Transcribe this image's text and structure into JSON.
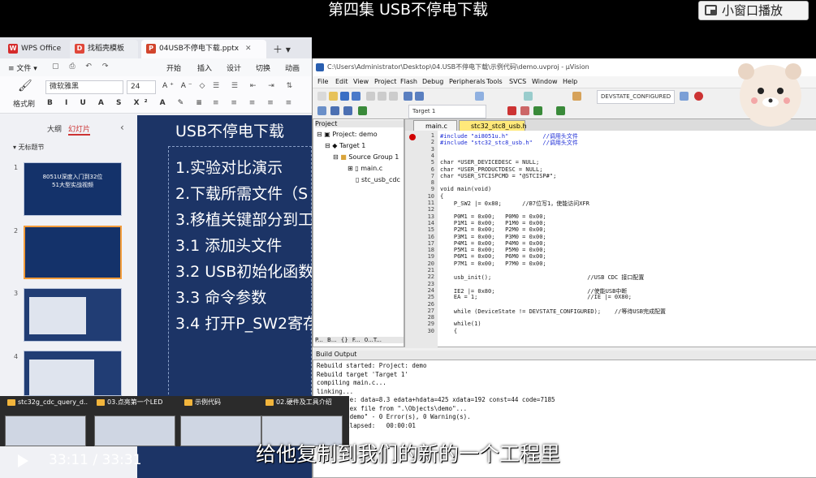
{
  "player": {
    "title": "第四集 USB不停电下载",
    "mini_window": "小窗口播放",
    "subtitle": "给他复制到我们的新的一个工程里",
    "time": "33:11 / 33:31"
  },
  "wps": {
    "tabs": [
      "WPS Office",
      "找稻壳模板",
      "04USB不停电下载.pptx"
    ],
    "menu": {
      "file": "文件",
      "items": [
        "开始",
        "插入",
        "设计",
        "切换",
        "动画"
      ]
    },
    "font": "微软雅黑",
    "size": "24",
    "format_painter": "格式刷",
    "side_tabs": [
      "大纲",
      "幻灯片"
    ],
    "section": "无标题节",
    "slide_numbers": [
      "1",
      "2",
      "3",
      "4"
    ],
    "thumb1_title": "8051U深度入门到32位\n51大型实战视频",
    "slide": {
      "title": "USB不停电下载",
      "lines": [
        "1.实验对比演示",
        "2.下载所需文件（S",
        "3.移植关键部分到工",
        "3.1 添加头文件",
        "3.2 USB初始化函数",
        "3.3 命令参数",
        "3.4 打开P_SW2寄存"
      ]
    }
  },
  "keil": {
    "title": "C:\\Users\\Administrator\\Desktop\\04.USB不停电下载\\示例代码\\demo.uvproj - µVision",
    "menu": [
      "File",
      "Edit",
      "View",
      "Project",
      "Flash",
      "Debug",
      "Peripherals",
      "Tools",
      "SVCS",
      "Window",
      "Help"
    ],
    "combo": "DEVSTATE_CONFIGURED",
    "target": "Target 1",
    "project_label": "Project",
    "tree": [
      "Project: demo",
      "Target 1",
      "Source Group 1",
      "main.c",
      "stc_usb_cdc"
    ],
    "panel_tabs": [
      "P...",
      "B...",
      "{} F...",
      "0...T..."
    ],
    "editor_tabs": [
      "main.c",
      "stc32_stc8_usb.h"
    ],
    "lines": [
      {
        "n": "1",
        "t": "#include \"ai8051u.h\"          //调用头文件",
        "c": "pp"
      },
      {
        "n": "2",
        "t": "#include \"stc32_stc8_usb.h\"   //调用头文件",
        "c": "pp"
      },
      {
        "n": "3",
        "t": "",
        "c": ""
      },
      {
        "n": "4",
        "t": "",
        "c": ""
      },
      {
        "n": "5",
        "t": "char *USER_DEVICEDESC = NULL;",
        "c": ""
      },
      {
        "n": "6",
        "t": "char *USER_PRODUCTDESC = NULL;",
        "c": ""
      },
      {
        "n": "7",
        "t": "char *USER_STCISPCMD = \"@STCISP#\";",
        "c": ""
      },
      {
        "n": "8",
        "t": "",
        "c": ""
      },
      {
        "n": "9",
        "t": "void main(void)",
        "c": ""
      },
      {
        "n": "10",
        "t": "{",
        "c": ""
      },
      {
        "n": "11",
        "t": "    P_SW2 |= 0x80;      //B7位写1，使能访问XFR",
        "c": ""
      },
      {
        "n": "12",
        "t": "",
        "c": ""
      },
      {
        "n": "13",
        "t": "    P0M1 = 0x00;   P0M0 = 0x00;",
        "c": ""
      },
      {
        "n": "14",
        "t": "    P1M1 = 0x00;   P1M0 = 0x00;",
        "c": ""
      },
      {
        "n": "15",
        "t": "    P2M1 = 0x00;   P2M0 = 0x00;",
        "c": ""
      },
      {
        "n": "16",
        "t": "    P3M1 = 0x00;   P3M0 = 0x00;",
        "c": ""
      },
      {
        "n": "17",
        "t": "    P4M1 = 0x00;   P4M0 = 0x00;",
        "c": ""
      },
      {
        "n": "18",
        "t": "    P5M1 = 0x00;   P5M0 = 0x00;",
        "c": ""
      },
      {
        "n": "19",
        "t": "    P6M1 = 0x00;   P6M0 = 0x00;",
        "c": ""
      },
      {
        "n": "20",
        "t": "    P7M1 = 0x00;   P7M0 = 0x00;",
        "c": ""
      },
      {
        "n": "21",
        "t": "",
        "c": ""
      },
      {
        "n": "22",
        "t": "    usb_init();                            //USB CDC 接口配置",
        "c": ""
      },
      {
        "n": "23",
        "t": "",
        "c": ""
      },
      {
        "n": "24",
        "t": "    IE2 |= 0x80;                           //使能USB中断",
        "c": ""
      },
      {
        "n": "25",
        "t": "    EA = 1;                                //IE |= 0X80;",
        "c": ""
      },
      {
        "n": "26",
        "t": "",
        "c": ""
      },
      {
        "n": "27",
        "t": "    while (DeviceState != DEVSTATE_CONFIGURED);    //等待USB完成配置",
        "c": ""
      },
      {
        "n": "28",
        "t": "",
        "c": ""
      },
      {
        "n": "29",
        "t": "    while(1)",
        "c": ""
      },
      {
        "n": "30",
        "t": "    {",
        "c": ""
      }
    ],
    "build_label": "Build Output",
    "build": [
      "Rebuild started: Project: demo",
      "Rebuild target 'Target 1'",
      "compiling main.c...",
      "linking...",
      "   am Size: data=8.3 edata+hdata=425 xdata=192 const=44 code=7185",
      "   ting hex file from \".\\Objects\\demo\"...",
      "   jects\\demo\" - 0 Error(s), 0 Warning(s).",
      "   Time Elapsed:   00:00:01"
    ]
  },
  "taskbar": [
    "stc32g_cdc_query_d...",
    "03.点亮第一个LED",
    "示例代码",
    "02.硬件及工具介绍"
  ]
}
